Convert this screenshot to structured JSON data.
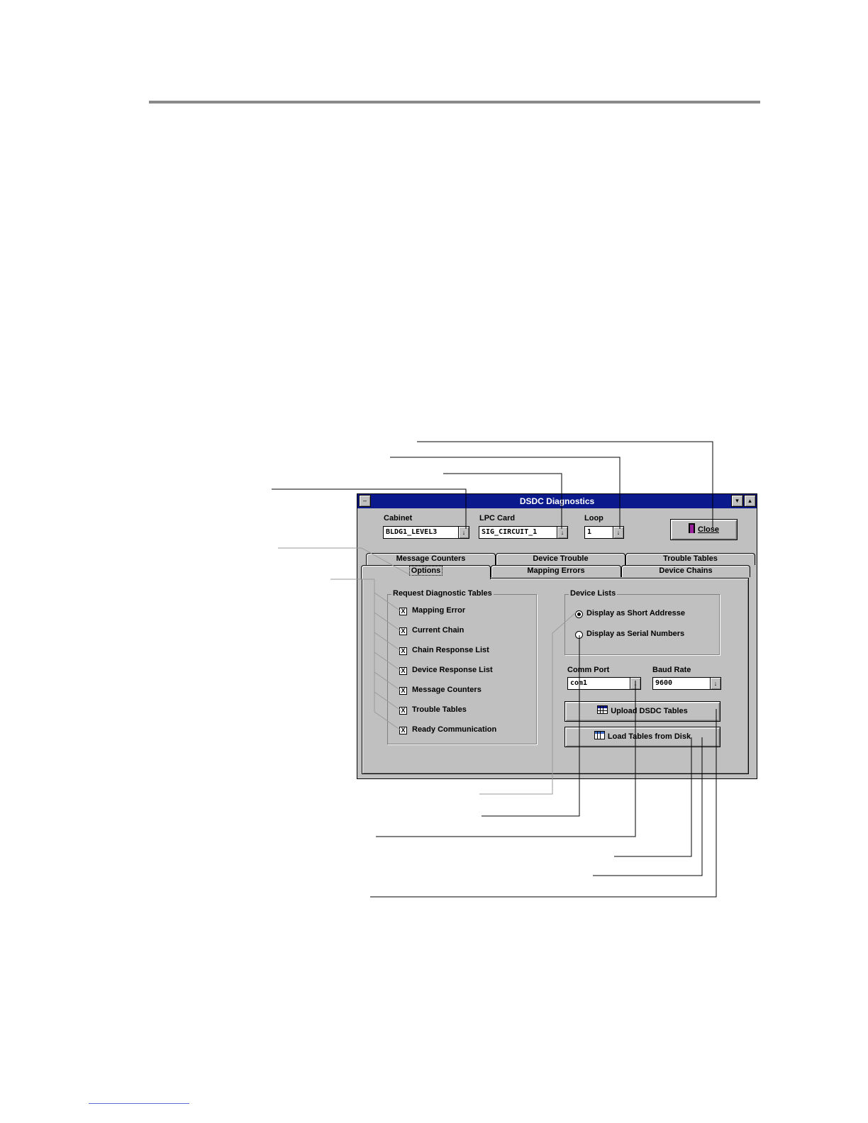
{
  "window": {
    "title": "DSDC Diagnostics",
    "minimize_symbol": "–",
    "scroll_down": "▾",
    "scroll_up": "▴"
  },
  "selectors": {
    "cabinet": {
      "label": "Cabinet",
      "value": "BLDG1_LEVEL3"
    },
    "lpc_card": {
      "label": "LPC Card",
      "value": "SIG_CIRCUIT_1"
    },
    "loop": {
      "label": "Loop",
      "value": "1"
    },
    "dropdown_arrow": "↓"
  },
  "close_button": {
    "label": "Close"
  },
  "tabs": {
    "back_row": [
      "Message Counters",
      "Device Trouble",
      "Trouble Tables"
    ],
    "front_row": [
      "Options",
      "Mapping Errors",
      "Device Chains"
    ],
    "active": "Options"
  },
  "request_group": {
    "title": "Request Diagnostic Tables",
    "check_mark": "X",
    "items": [
      {
        "label": "Mapping Error",
        "checked": true
      },
      {
        "label": "Current Chain",
        "checked": true
      },
      {
        "label": "Chain Response List",
        "checked": true
      },
      {
        "label": "Device Response List",
        "checked": true
      },
      {
        "label": "Message Counters",
        "checked": true
      },
      {
        "label": "Trouble Tables",
        "checked": true
      },
      {
        "label": "Ready Communication",
        "checked": true
      }
    ]
  },
  "device_lists": {
    "title": "Device Lists",
    "options": [
      {
        "label": "Display as Short Addresse",
        "selected": true
      },
      {
        "label": "Display as Serial Numbers",
        "selected": false
      }
    ]
  },
  "comm_port": {
    "label": "Comm Port",
    "value": "com1"
  },
  "baud_rate": {
    "label": "Baud Rate",
    "value": "9600"
  },
  "upload_button": {
    "label": "Upload DSDC Tables"
  },
  "load_button": {
    "label": "Load Tables from Disk"
  },
  "colors": {
    "title_bar": "#0a1a8c",
    "face": "#c0c0c0",
    "rule": "#8a8a8a"
  }
}
